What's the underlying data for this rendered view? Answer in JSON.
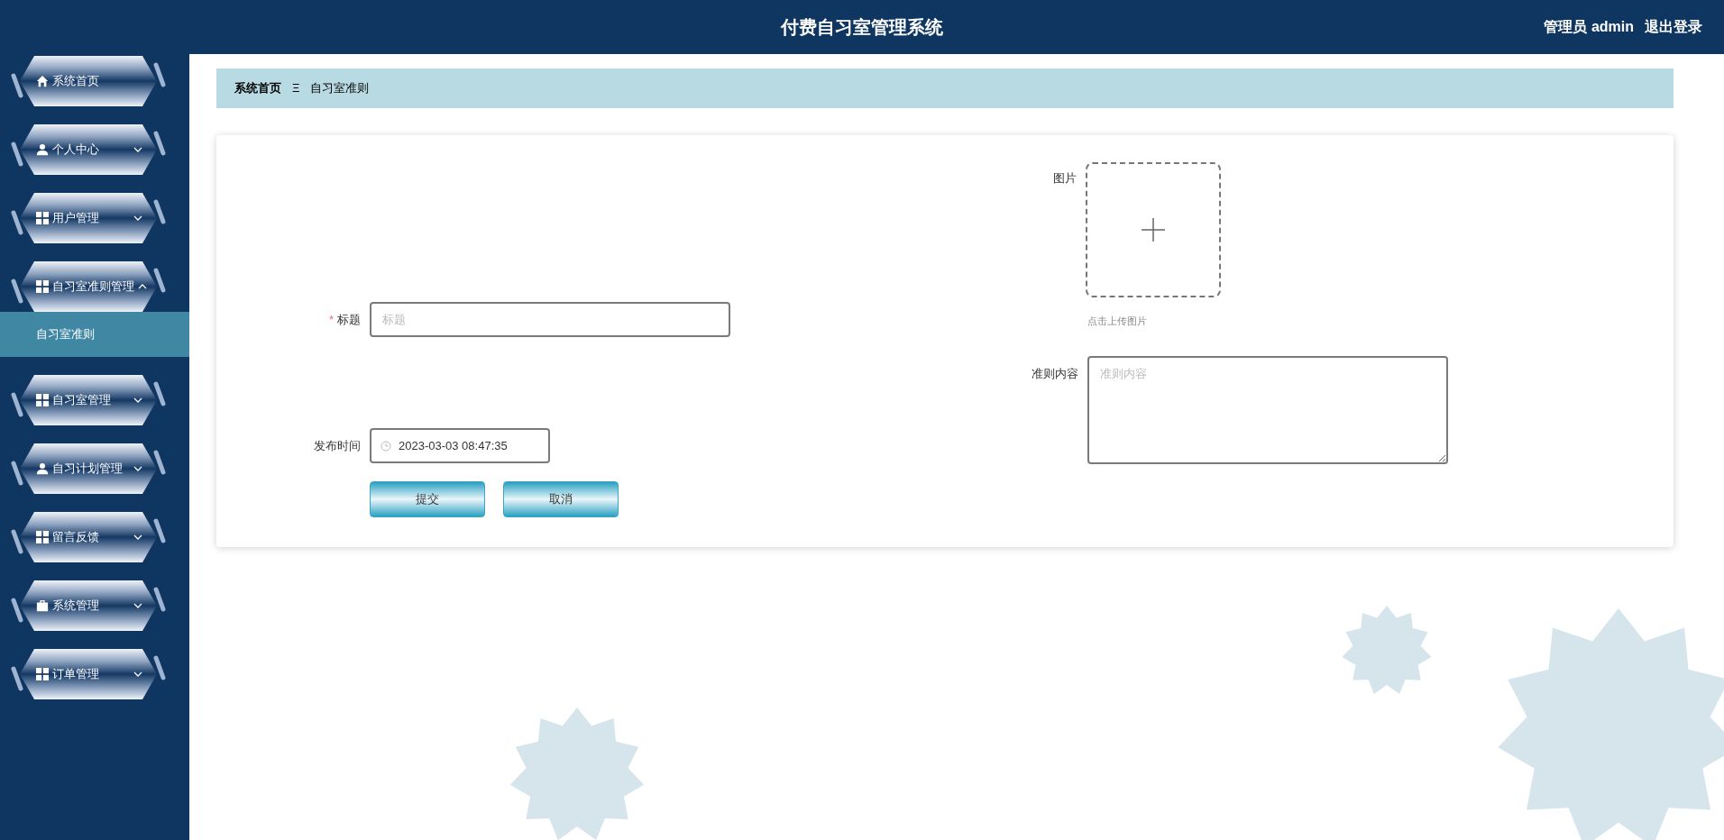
{
  "header": {
    "title": "付费自习室管理系统",
    "user": "管理员 admin",
    "logout": "退出登录"
  },
  "sidebar": {
    "items": [
      {
        "kind": "link",
        "label": "系统首页"
      },
      {
        "kind": "menu",
        "label": "个人中心",
        "expanded": false
      },
      {
        "kind": "menu",
        "label": "用户管理",
        "expanded": false
      },
      {
        "kind": "menu",
        "label": "自习室准则管理",
        "expanded": true,
        "children": [
          {
            "label": "自习室准则",
            "selected": true
          }
        ]
      },
      {
        "kind": "menu",
        "label": "自习室管理",
        "expanded": false
      },
      {
        "kind": "menu",
        "label": "自习计划管理",
        "expanded": false
      },
      {
        "kind": "menu",
        "label": "留言反馈",
        "expanded": false
      },
      {
        "kind": "menu",
        "label": "系统管理",
        "expanded": false
      },
      {
        "kind": "menu",
        "label": "订单管理",
        "expanded": false
      }
    ]
  },
  "breadcrumb": {
    "home": "系统首页",
    "separator": "Ξ",
    "current": "自习室准则"
  },
  "form": {
    "title": {
      "label": "标题",
      "required_mark": "*",
      "placeholder": "标题"
    },
    "publish_time": {
      "label": "发布时间",
      "value": "2023-03-03 08:47:35"
    },
    "image": {
      "label": "图片",
      "hint": "点击上传图片"
    },
    "content": {
      "label": "准则内容",
      "placeholder": "准则内容"
    },
    "buttons": [
      "提交",
      "取消"
    ]
  }
}
